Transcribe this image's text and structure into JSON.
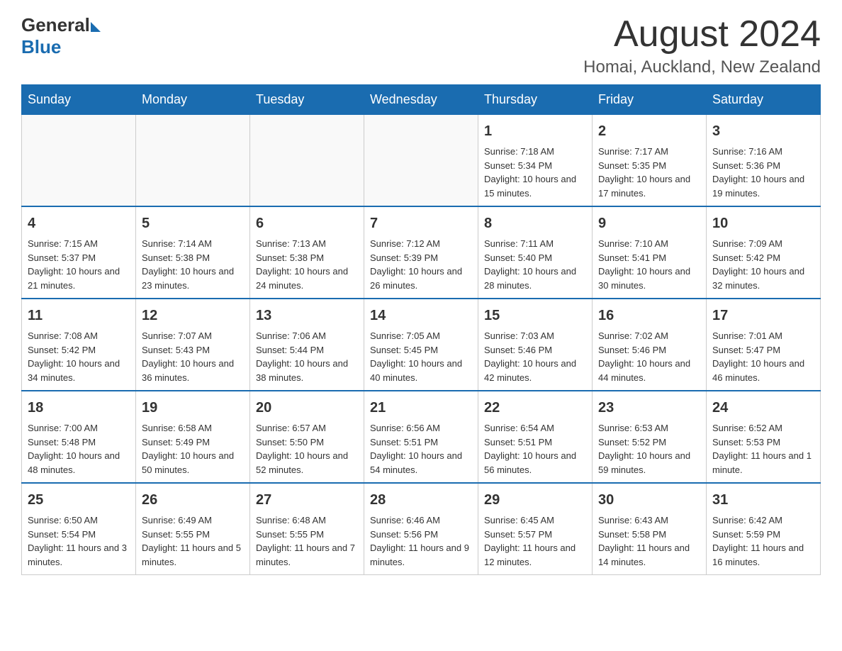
{
  "header": {
    "logo_general": "General",
    "logo_blue": "Blue",
    "title": "August 2024",
    "subtitle": "Homai, Auckland, New Zealand"
  },
  "days_of_week": [
    "Sunday",
    "Monday",
    "Tuesday",
    "Wednesday",
    "Thursday",
    "Friday",
    "Saturday"
  ],
  "weeks": [
    [
      {
        "day": "",
        "info": ""
      },
      {
        "day": "",
        "info": ""
      },
      {
        "day": "",
        "info": ""
      },
      {
        "day": "",
        "info": ""
      },
      {
        "day": "1",
        "info": "Sunrise: 7:18 AM\nSunset: 5:34 PM\nDaylight: 10 hours and 15 minutes."
      },
      {
        "day": "2",
        "info": "Sunrise: 7:17 AM\nSunset: 5:35 PM\nDaylight: 10 hours and 17 minutes."
      },
      {
        "day": "3",
        "info": "Sunrise: 7:16 AM\nSunset: 5:36 PM\nDaylight: 10 hours and 19 minutes."
      }
    ],
    [
      {
        "day": "4",
        "info": "Sunrise: 7:15 AM\nSunset: 5:37 PM\nDaylight: 10 hours and 21 minutes."
      },
      {
        "day": "5",
        "info": "Sunrise: 7:14 AM\nSunset: 5:38 PM\nDaylight: 10 hours and 23 minutes."
      },
      {
        "day": "6",
        "info": "Sunrise: 7:13 AM\nSunset: 5:38 PM\nDaylight: 10 hours and 24 minutes."
      },
      {
        "day": "7",
        "info": "Sunrise: 7:12 AM\nSunset: 5:39 PM\nDaylight: 10 hours and 26 minutes."
      },
      {
        "day": "8",
        "info": "Sunrise: 7:11 AM\nSunset: 5:40 PM\nDaylight: 10 hours and 28 minutes."
      },
      {
        "day": "9",
        "info": "Sunrise: 7:10 AM\nSunset: 5:41 PM\nDaylight: 10 hours and 30 minutes."
      },
      {
        "day": "10",
        "info": "Sunrise: 7:09 AM\nSunset: 5:42 PM\nDaylight: 10 hours and 32 minutes."
      }
    ],
    [
      {
        "day": "11",
        "info": "Sunrise: 7:08 AM\nSunset: 5:42 PM\nDaylight: 10 hours and 34 minutes."
      },
      {
        "day": "12",
        "info": "Sunrise: 7:07 AM\nSunset: 5:43 PM\nDaylight: 10 hours and 36 minutes."
      },
      {
        "day": "13",
        "info": "Sunrise: 7:06 AM\nSunset: 5:44 PM\nDaylight: 10 hours and 38 minutes."
      },
      {
        "day": "14",
        "info": "Sunrise: 7:05 AM\nSunset: 5:45 PM\nDaylight: 10 hours and 40 minutes."
      },
      {
        "day": "15",
        "info": "Sunrise: 7:03 AM\nSunset: 5:46 PM\nDaylight: 10 hours and 42 minutes."
      },
      {
        "day": "16",
        "info": "Sunrise: 7:02 AM\nSunset: 5:46 PM\nDaylight: 10 hours and 44 minutes."
      },
      {
        "day": "17",
        "info": "Sunrise: 7:01 AM\nSunset: 5:47 PM\nDaylight: 10 hours and 46 minutes."
      }
    ],
    [
      {
        "day": "18",
        "info": "Sunrise: 7:00 AM\nSunset: 5:48 PM\nDaylight: 10 hours and 48 minutes."
      },
      {
        "day": "19",
        "info": "Sunrise: 6:58 AM\nSunset: 5:49 PM\nDaylight: 10 hours and 50 minutes."
      },
      {
        "day": "20",
        "info": "Sunrise: 6:57 AM\nSunset: 5:50 PM\nDaylight: 10 hours and 52 minutes."
      },
      {
        "day": "21",
        "info": "Sunrise: 6:56 AM\nSunset: 5:51 PM\nDaylight: 10 hours and 54 minutes."
      },
      {
        "day": "22",
        "info": "Sunrise: 6:54 AM\nSunset: 5:51 PM\nDaylight: 10 hours and 56 minutes."
      },
      {
        "day": "23",
        "info": "Sunrise: 6:53 AM\nSunset: 5:52 PM\nDaylight: 10 hours and 59 minutes."
      },
      {
        "day": "24",
        "info": "Sunrise: 6:52 AM\nSunset: 5:53 PM\nDaylight: 11 hours and 1 minute."
      }
    ],
    [
      {
        "day": "25",
        "info": "Sunrise: 6:50 AM\nSunset: 5:54 PM\nDaylight: 11 hours and 3 minutes."
      },
      {
        "day": "26",
        "info": "Sunrise: 6:49 AM\nSunset: 5:55 PM\nDaylight: 11 hours and 5 minutes."
      },
      {
        "day": "27",
        "info": "Sunrise: 6:48 AM\nSunset: 5:55 PM\nDaylight: 11 hours and 7 minutes."
      },
      {
        "day": "28",
        "info": "Sunrise: 6:46 AM\nSunset: 5:56 PM\nDaylight: 11 hours and 9 minutes."
      },
      {
        "day": "29",
        "info": "Sunrise: 6:45 AM\nSunset: 5:57 PM\nDaylight: 11 hours and 12 minutes."
      },
      {
        "day": "30",
        "info": "Sunrise: 6:43 AM\nSunset: 5:58 PM\nDaylight: 11 hours and 14 minutes."
      },
      {
        "day": "31",
        "info": "Sunrise: 6:42 AM\nSunset: 5:59 PM\nDaylight: 11 hours and 16 minutes."
      }
    ]
  ]
}
